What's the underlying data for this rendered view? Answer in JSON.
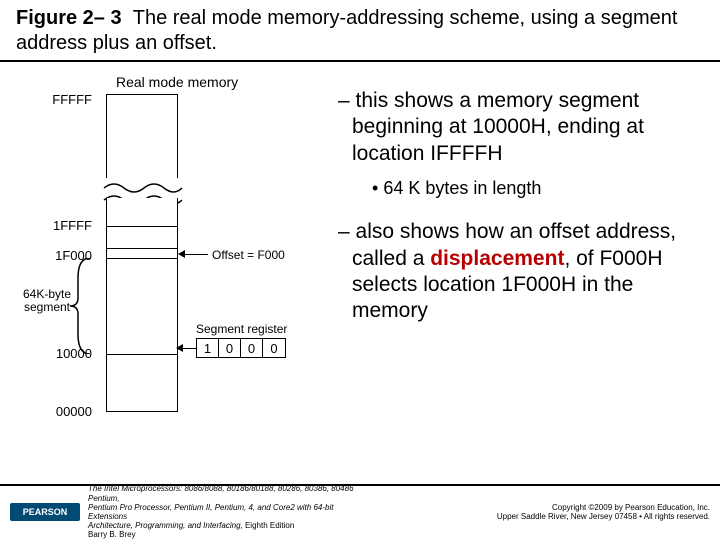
{
  "figure": {
    "number": "Figure 2– 3",
    "caption": "The real mode memory-addressing scheme, using a segment address plus an offset."
  },
  "diagram": {
    "title": "Real mode memory",
    "addresses": {
      "top": "FFFFF",
      "seg_end": "1FFFF",
      "offset_loc": "1F000",
      "seg_start": "10000",
      "bottom": "00000"
    },
    "brace_label_line1": "64K-byte",
    "brace_label_line2": "segment",
    "offset_label": "Offset = F000",
    "seg_reg_label": "Segment register",
    "seg_reg_digits": [
      "1",
      "0",
      "0",
      "0"
    ]
  },
  "notes": {
    "b1": "this shows a memory segment beginning at 10000H, ending at location IFFFFH",
    "b1sub": "64 K bytes in length",
    "b2a": "also shows how an offset address, called a ",
    "b2disp": "displacement",
    "b2b": ", of F000H selects location 1F000H in the memory"
  },
  "footer": {
    "pearson": "PEARSON",
    "book_line1": "The Intel Microprocessors: 8086/8088, 80186/80188, 80286, 80386, 80486 Pentium,",
    "book_line2": "Pentium Pro Processor, Pentium II, Pentium, 4, and Core2 with 64-bit Extensions",
    "book_line3": "Architecture, Programming, and Interfacing",
    "book_edition": ", Eighth Edition",
    "book_author": "Barry B. Brey",
    "copy_line1": "Copyright ©2009 by Pearson Education, Inc.",
    "copy_line2": "Upper Saddle River, New Jersey 07458 • All rights reserved."
  }
}
